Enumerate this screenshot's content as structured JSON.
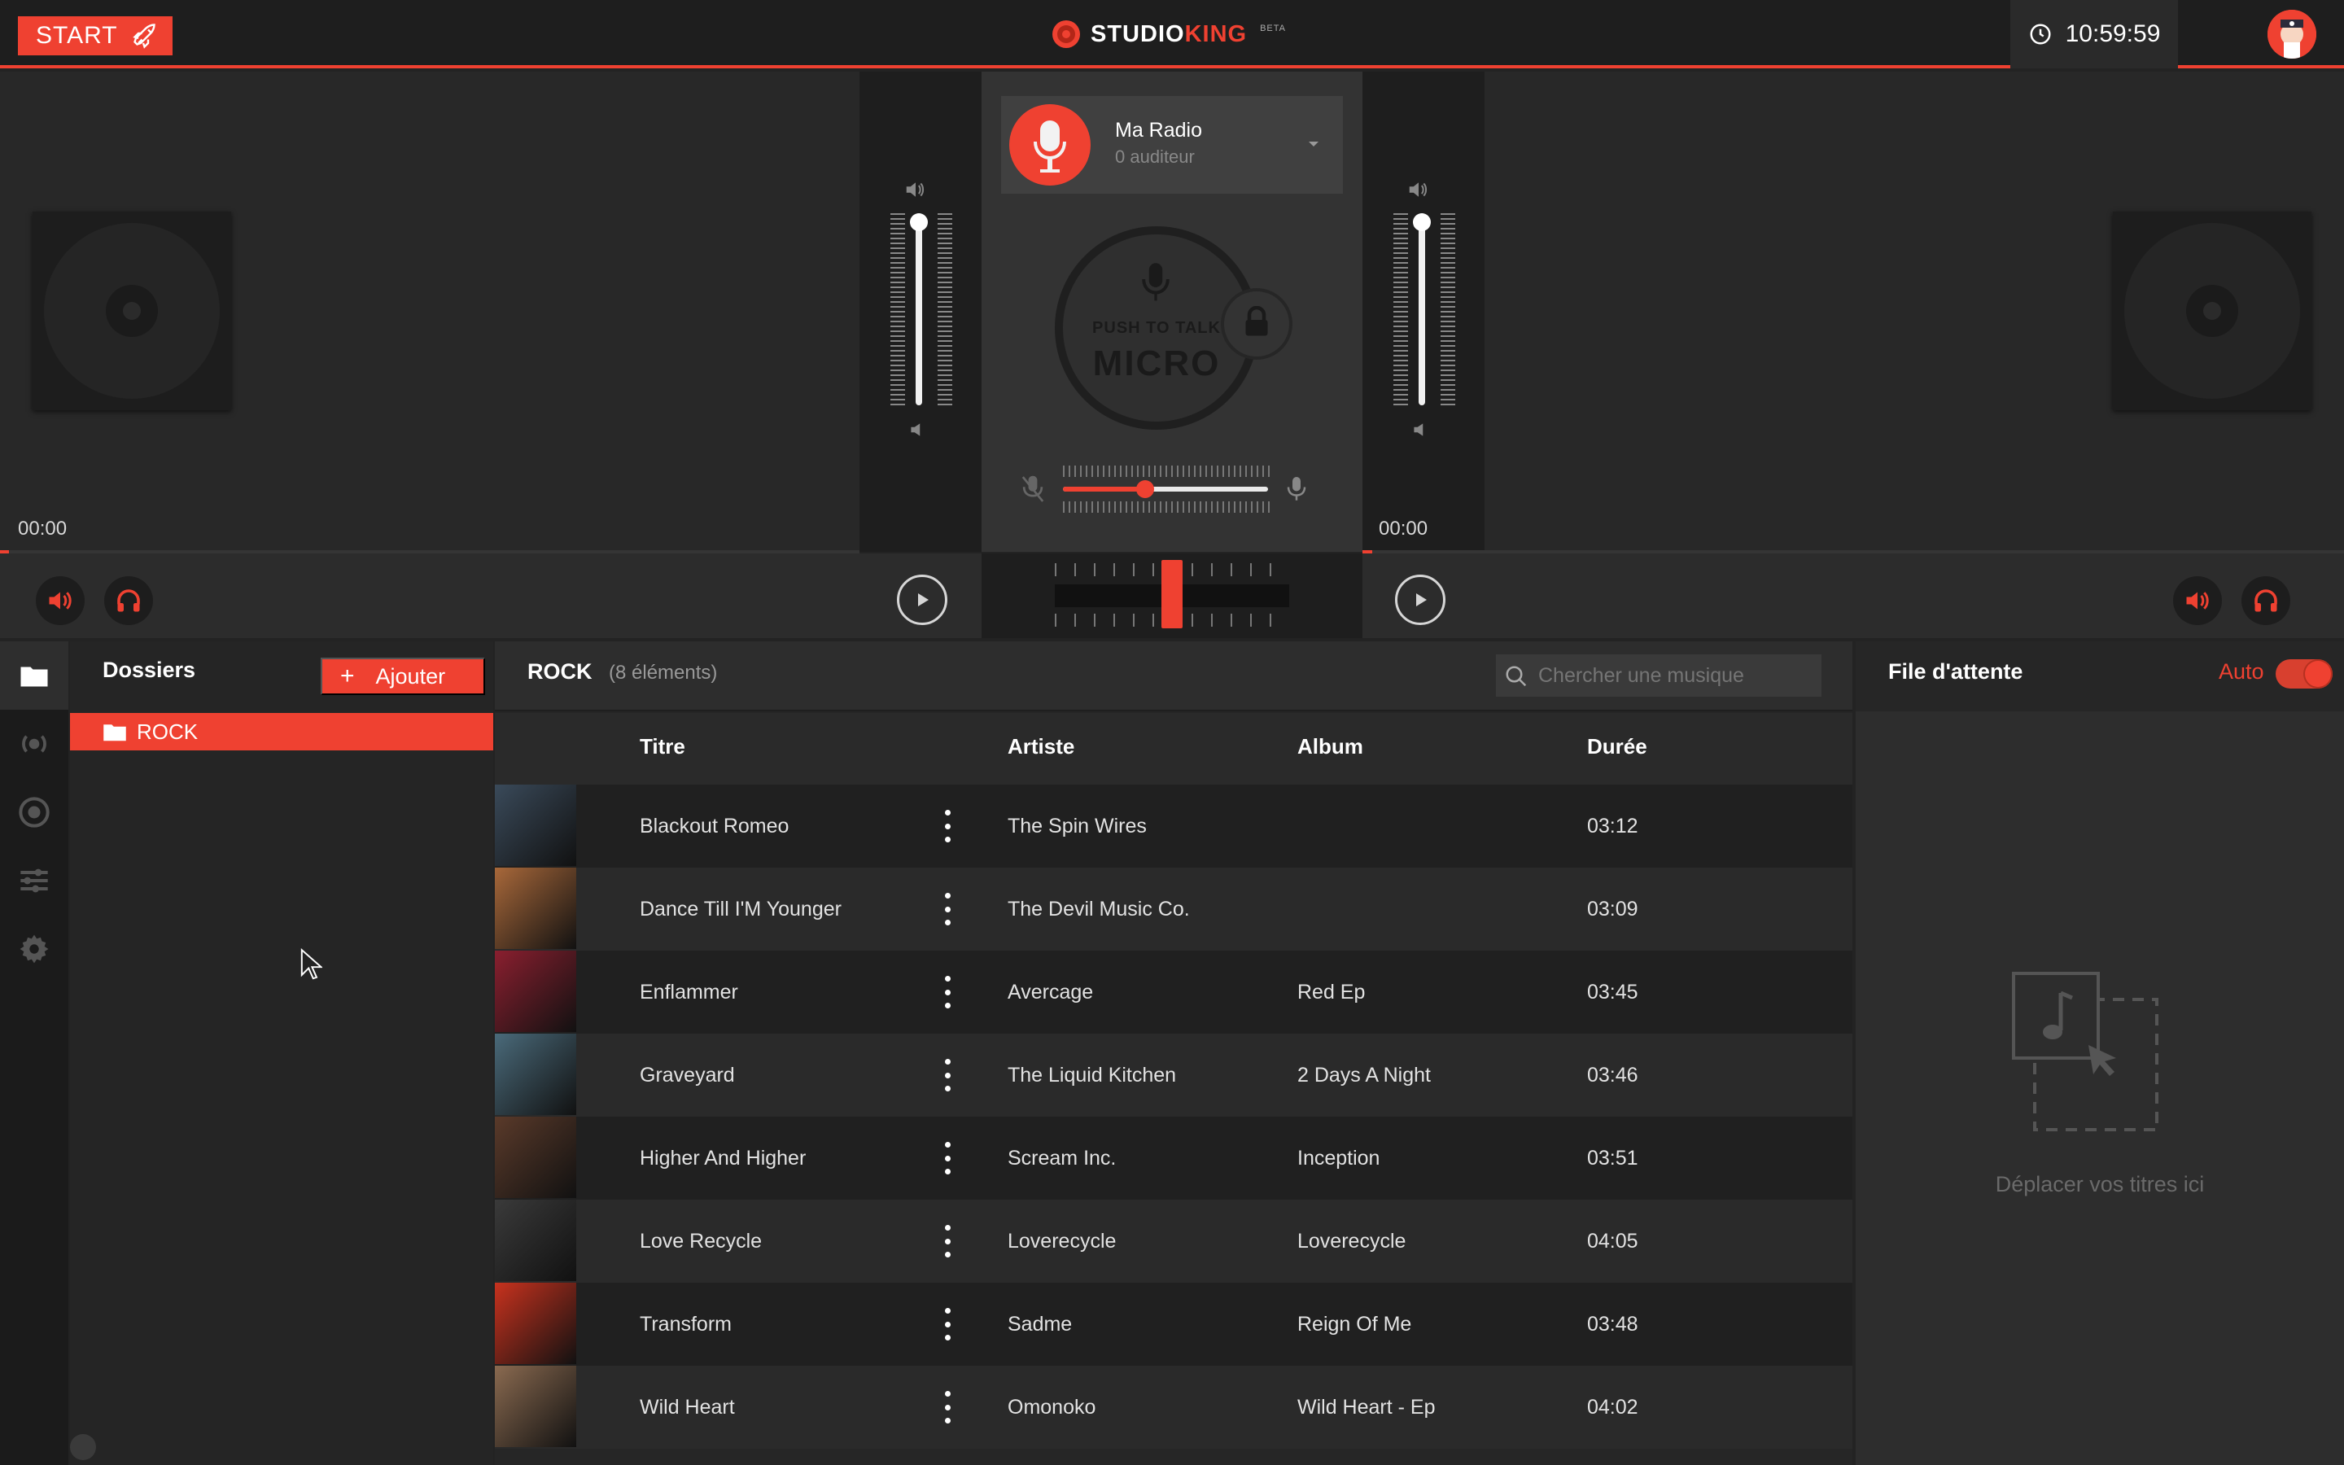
{
  "topbar": {
    "start_label": "START",
    "brand_studio": "STUDIO",
    "brand_king": "KING",
    "brand_beta": "BETA",
    "clock": "10:59:59"
  },
  "radio": {
    "name": "Ma Radio",
    "listeners": "0 auditeur"
  },
  "mic": {
    "push_label": "PUSH TO TALK",
    "big_label": "MICRO",
    "level": 0.4
  },
  "deck_left": {
    "time": "00:00",
    "progress": 0.01
  },
  "deck_right": {
    "time": "00:00",
    "progress": 0.01
  },
  "crossfader": {
    "position": 0.5
  },
  "folders": {
    "title": "Dossiers",
    "add_label": "Ajouter",
    "items": [
      {
        "label": "ROCK"
      }
    ]
  },
  "tracklist": {
    "title": "ROCK",
    "count": "(8 éléments)",
    "search_placeholder": "Chercher une musique",
    "columns": {
      "title": "Titre",
      "artist": "Artiste",
      "album": "Album",
      "duration": "Durée"
    },
    "rows": [
      {
        "title": "Blackout Romeo",
        "artist": "The Spin Wires",
        "album": "",
        "duration": "03:12",
        "cover": "#3a4a5a"
      },
      {
        "title": "Dance Till I'M Younger",
        "artist": "The Devil Music Co.",
        "album": "",
        "duration": "03:09",
        "cover": "#a8683a"
      },
      {
        "title": "Enflammer",
        "artist": "Avercage",
        "album": "Red Ep",
        "duration": "03:45",
        "cover": "#8a1f2f"
      },
      {
        "title": "Graveyard",
        "artist": "The Liquid Kitchen",
        "album": "2 Days A Night",
        "duration": "03:46",
        "cover": "#4a6a7a"
      },
      {
        "title": "Higher And Higher",
        "artist": "Scream Inc.",
        "album": "Inception",
        "duration": "03:51",
        "cover": "#5a3a2a"
      },
      {
        "title": "Love Recycle",
        "artist": "Loverecycle",
        "album": "Loverecycle",
        "duration": "04:05",
        "cover": "#3a3a3a"
      },
      {
        "title": "Transform",
        "artist": "Sadme",
        "album": "Reign Of Me",
        "duration": "03:48",
        "cover": "#c8321e"
      },
      {
        "title": "Wild Heart",
        "artist": "Omonoko",
        "album": "Wild Heart - Ep",
        "duration": "04:02",
        "cover": "#8a6a50"
      }
    ]
  },
  "queue": {
    "title": "File d'attente",
    "auto_label": "Auto",
    "drop_hint": "Déplacer vos titres ici"
  },
  "colors": {
    "accent": "#ef4131",
    "background": "#232323"
  }
}
